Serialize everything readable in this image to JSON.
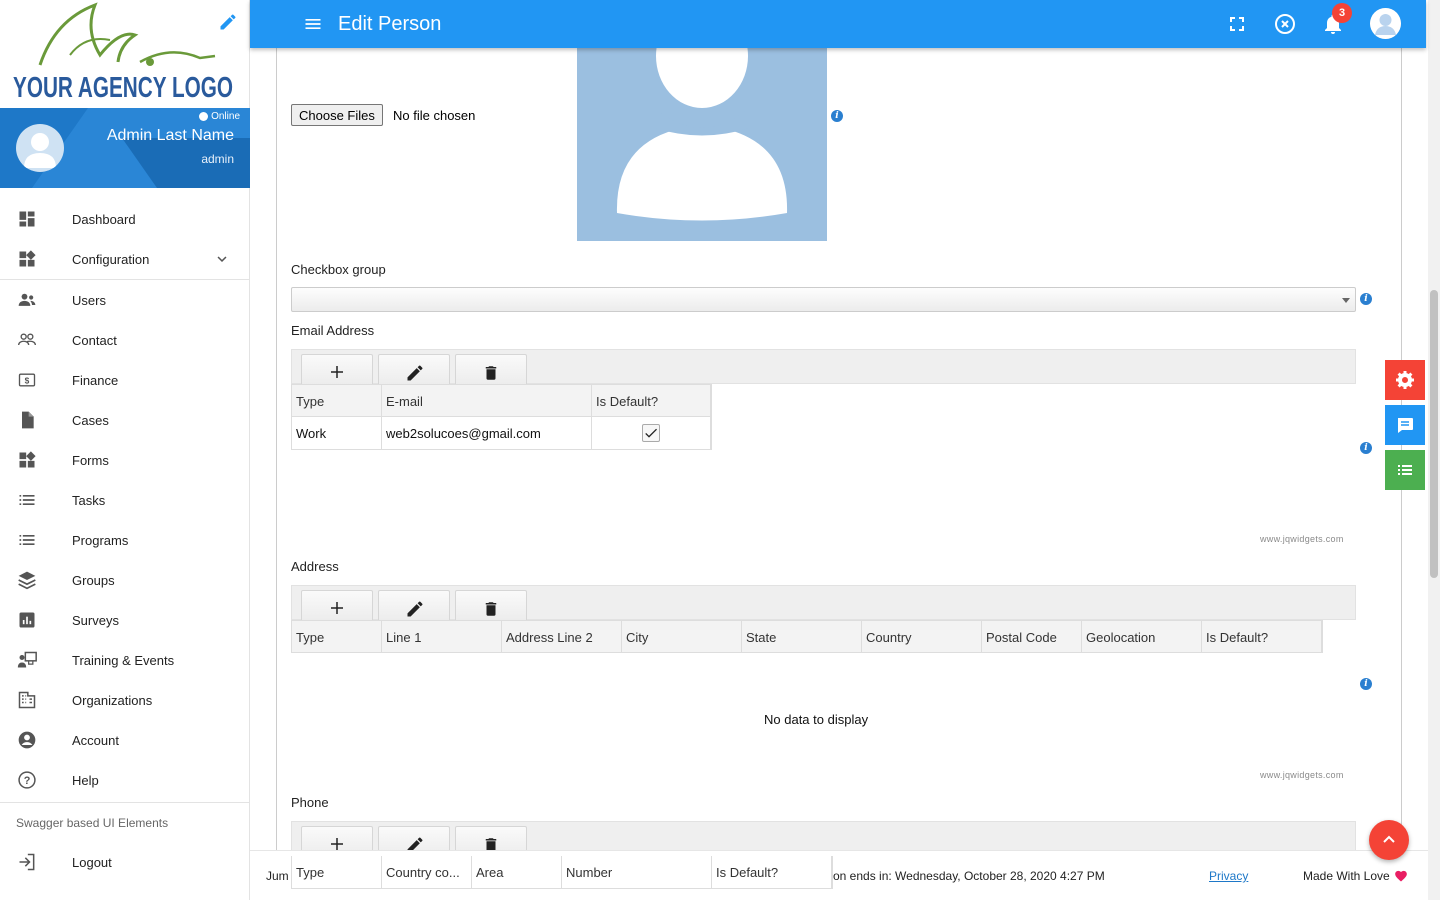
{
  "app": {
    "logo_text": "YOUR AGENCY LOGO",
    "page_title": "Edit Person",
    "notification_count": "3",
    "brand_color": "#2196f3"
  },
  "user": {
    "status": "Online",
    "name": "Admin Last Name",
    "role": "admin"
  },
  "nav": {
    "items": [
      {
        "label": "Dashboard",
        "icon": "dashboard-icon"
      },
      {
        "label": "Configuration",
        "icon": "widgets-icon"
      },
      {
        "label": "Users",
        "icon": "users-icon"
      },
      {
        "label": "Contact",
        "icon": "contact-icon"
      },
      {
        "label": "Finance",
        "icon": "dollar-icon"
      },
      {
        "label": "Cases",
        "icon": "file-icon"
      },
      {
        "label": "Forms",
        "icon": "widgets-icon"
      },
      {
        "label": "Tasks",
        "icon": "list-icon"
      },
      {
        "label": "Programs",
        "icon": "list-icon"
      },
      {
        "label": "Groups",
        "icon": "layers-icon"
      },
      {
        "label": "Surveys",
        "icon": "chart-icon"
      },
      {
        "label": "Training & Events",
        "icon": "presentation-icon"
      },
      {
        "label": "Organizations",
        "icon": "building-icon"
      },
      {
        "label": "Account",
        "icon": "account-circle-icon"
      },
      {
        "label": "Help",
        "icon": "help-icon"
      }
    ],
    "section_title": "Swagger based UI Elements",
    "logout_label": "Logout"
  },
  "form": {
    "file_button": "Choose Files",
    "file_status": "No file chosen",
    "checkbox_group_label": "Checkbox group",
    "email_label": "Email Address",
    "email_columns": [
      "Type",
      "E-mail",
      "Is Default?"
    ],
    "email_rows": [
      {
        "type": "Work",
        "email": "web2solucoes@gmail.com",
        "is_default": true
      }
    ],
    "address_label": "Address",
    "address_columns": [
      "Type",
      "Line 1",
      "Address Line 2",
      "City",
      "State",
      "Country",
      "Postal Code",
      "Geolocation",
      "Is Default?"
    ],
    "no_data": "No data to display",
    "phone_label": "Phone",
    "phone_columns": [
      "Type",
      "Country co...",
      "Area",
      "Number",
      "Is Default?"
    ],
    "jqwidgets_credit": "www.jqwidgets.com"
  },
  "footer": {
    "left_text": "Jum",
    "session_text": "on ends in: Wednesday, October 28, 2020 4:27 PM",
    "privacy": "Privacy",
    "made_with": "Made With Love"
  },
  "colors": {
    "settings_button": "#f44336",
    "chat_button": "#2196f3",
    "list_button": "#4caf50",
    "heart": "#e91e63"
  }
}
